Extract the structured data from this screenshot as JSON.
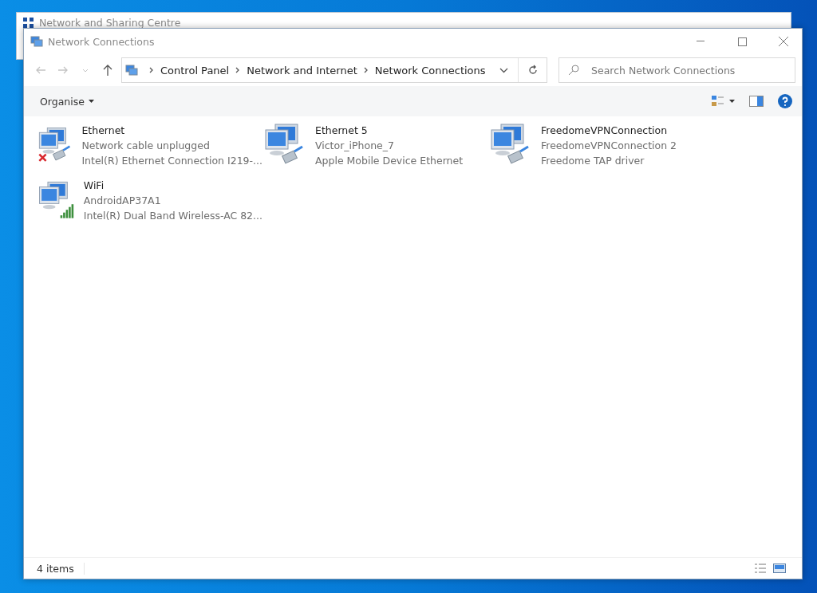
{
  "back_window": {
    "title": "Network and Sharing Centre"
  },
  "window": {
    "title": "Network Connections"
  },
  "address_bar": {
    "crumbs": [
      "Control Panel",
      "Network and Internet",
      "Network Connections"
    ]
  },
  "search": {
    "placeholder": "Search Network Connections"
  },
  "toolbar": {
    "organise": "Organise"
  },
  "adapters": [
    {
      "kind": "ethernet",
      "name": "Ethernet",
      "status": "Network cable unplugged",
      "device": "Intel(R) Ethernet Connection I219-...",
      "disconnected": true
    },
    {
      "kind": "ethernet",
      "name": "Ethernet 5",
      "status": "Victor_iPhone_7",
      "device": "Apple Mobile Device Ethernet",
      "disconnected": false
    },
    {
      "kind": "ethernet",
      "name": "FreedomeVPNConnection",
      "status": "FreedomeVPNConnection 2",
      "device": "Freedome TAP driver",
      "disconnected": false
    },
    {
      "kind": "wifi",
      "name": "WiFi",
      "status": "AndroidAP37A1",
      "device": "Intel(R) Dual Band Wireless-AC 82...",
      "disconnected": false
    }
  ],
  "status_bar": {
    "count": "4 items"
  }
}
